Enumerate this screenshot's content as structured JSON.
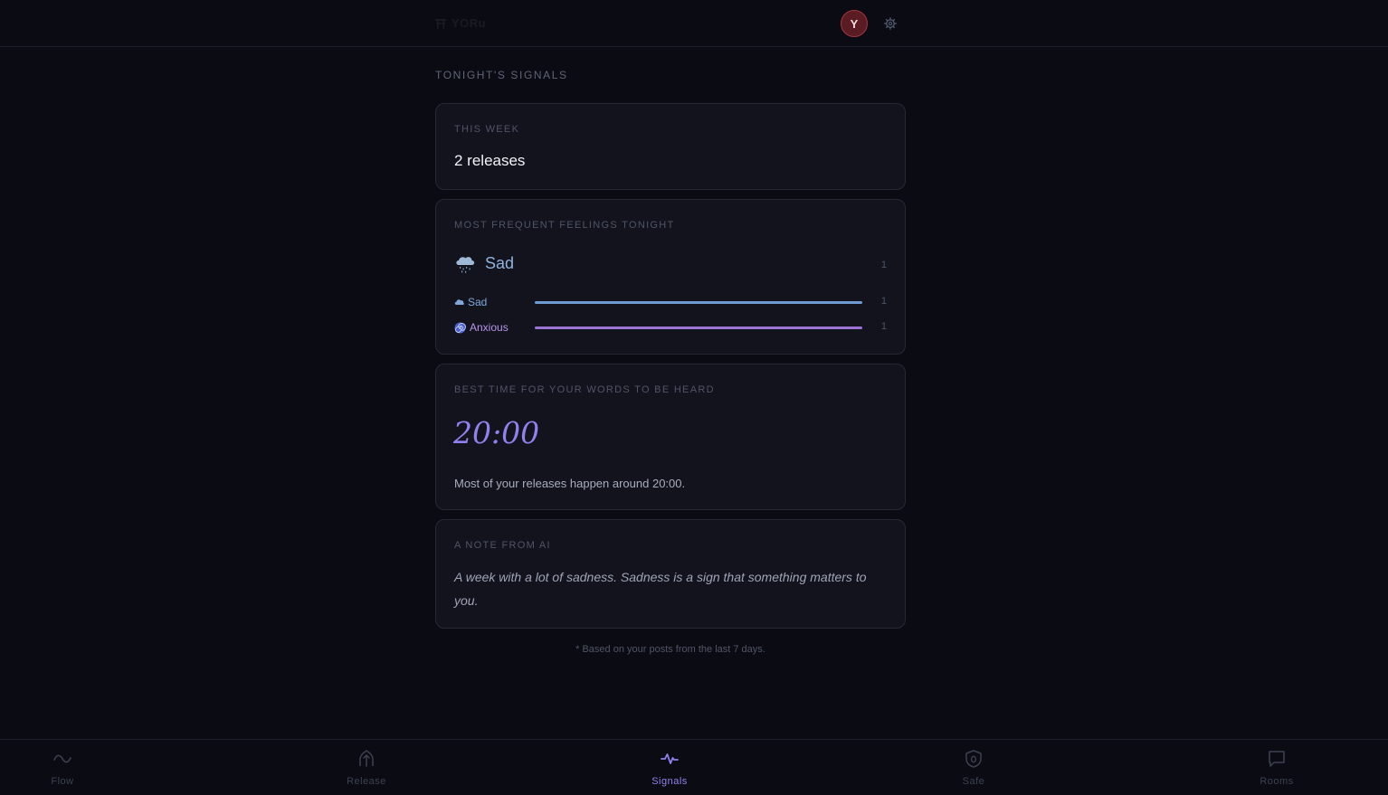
{
  "header": {
    "brand": "YORu",
    "avatar_initial": "Y"
  },
  "page": {
    "section_title": "TONIGHT'S SIGNALS"
  },
  "week_card": {
    "label": "THIS WEEK",
    "value": "2 releases"
  },
  "feelings_card": {
    "label": "MOST FREQUENT FEELINGS TONIGHT",
    "top": {
      "name": "Sad",
      "icon": "rain-cloud-icon",
      "count": "1",
      "color": "#8fb3de"
    },
    "items": [
      {
        "name": "Sad",
        "icon": "cloud-icon",
        "count": "1",
        "fraction": 1.0,
        "color": "#6f9bd2"
      },
      {
        "name": "Anxious",
        "icon": "spiral-icon",
        "count": "1",
        "fraction": 1.0,
        "color": "#9b74d6"
      }
    ]
  },
  "time_card": {
    "label": "BEST TIME FOR YOUR WORDS TO BE HEARD",
    "value": "20:00",
    "description": "Most of your releases happen around 20:00."
  },
  "note_card": {
    "label": "A NOTE FROM AI",
    "text": "A week with a lot of sadness. Sadness is a sign that something matters to you."
  },
  "footnote": "* Based on your posts from the last 7 days.",
  "nav": {
    "items": [
      {
        "label": "Flow",
        "icon": "wave-icon",
        "active": false
      },
      {
        "label": "Release",
        "icon": "release-icon",
        "active": false
      },
      {
        "label": "Signals",
        "icon": "pulse-icon",
        "active": true
      },
      {
        "label": "Safe",
        "icon": "shield-icon",
        "active": false
      },
      {
        "label": "Rooms",
        "icon": "chat-bubble-icon",
        "active": false
      }
    ]
  },
  "colors": {
    "accent": "#8f82f0",
    "background": "#0b0c13",
    "card": "#12131c"
  }
}
